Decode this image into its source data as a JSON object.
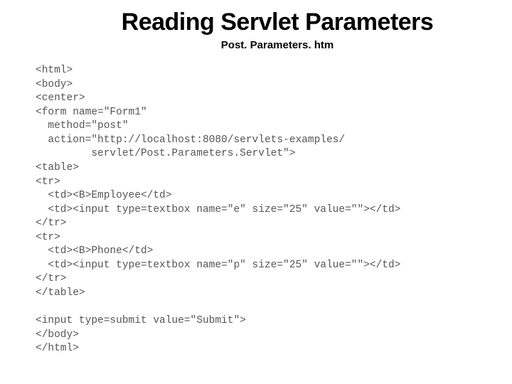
{
  "slide": {
    "title": "Reading Servlet Parameters",
    "subtitle": "Post. Parameters. htm",
    "code": "<html>\n<body>\n<center>\n<form name=\"Form1\"\n  method=\"post\"\n  action=\"http://localhost:8080/servlets-examples/\n         servlet/Post.Parameters.Servlet\">\n<table>\n<tr>\n  <td><B>Employee</td>\n  <td><input type=textbox name=\"e\" size=\"25\" value=\"\"></td>\n</tr>\n<tr>\n  <td><B>Phone</td>\n  <td><input type=textbox name=\"p\" size=\"25\" value=\"\"></td>\n</tr>\n</table>\n\n<input type=submit value=\"Submit\">\n</body>\n</html>"
  }
}
